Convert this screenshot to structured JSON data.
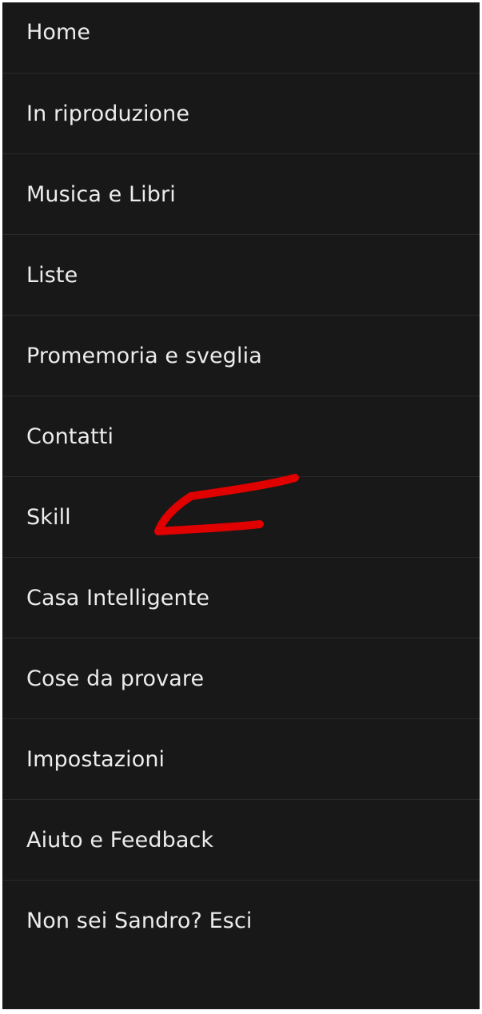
{
  "menu": {
    "items": [
      {
        "label": "Home"
      },
      {
        "label": "In riproduzione"
      },
      {
        "label": "Musica e Libri"
      },
      {
        "label": "Liste"
      },
      {
        "label": "Promemoria e sveglia"
      },
      {
        "label": "Contatti"
      },
      {
        "label": "Skill"
      },
      {
        "label": "Casa Intelligente"
      },
      {
        "label": "Cose da provare"
      },
      {
        "label": "Impostazioni"
      },
      {
        "label": "Aiuto e Feedback"
      },
      {
        "label": "Non sei Sandro? Esci"
      }
    ]
  },
  "colors": {
    "background": "#181818",
    "text": "#ececec",
    "divider": "#2a2a2a",
    "annotation_arrow": "#e00000"
  },
  "annotation": {
    "icon": "red-arrow-icon"
  }
}
